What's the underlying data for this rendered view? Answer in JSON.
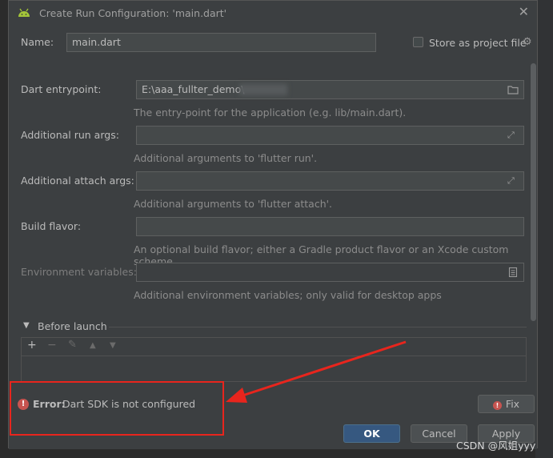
{
  "dialog": {
    "title": "Create Run Configuration: 'main.dart'",
    "close_glyph": "✕"
  },
  "name_row": {
    "label": "Name:",
    "value": "main.dart"
  },
  "store_project": {
    "label": "Store as project file",
    "checked": false,
    "icon": "gear-icon"
  },
  "fields": [
    {
      "label": "Dart entrypoint:",
      "value": "E:\\aaa_fullter_demo\\",
      "hint": "The entry-point for the application (e.g. lib/main.dart).",
      "icon": "folder-icon",
      "disabled": false
    },
    {
      "label": "Additional run args:",
      "value": "",
      "hint": "Additional arguments to 'flutter run'.",
      "icon": "expand-icon",
      "disabled": false
    },
    {
      "label": "Additional attach args:",
      "value": "",
      "hint": "Additional arguments to 'flutter attach'.",
      "icon": "expand-icon",
      "disabled": false
    },
    {
      "label": "Build flavor:",
      "value": "",
      "hint": "An optional build flavor; either a Gradle product flavor or an Xcode custom scheme.",
      "icon": "",
      "disabled": false
    },
    {
      "label": "Environment variables:",
      "value": "",
      "hint": "Additional environment variables; only valid for desktop apps",
      "icon": "document-icon",
      "disabled": true
    }
  ],
  "before_launch": {
    "label": "Before launch",
    "toolbar": [
      {
        "glyph": "+",
        "name": "add-icon",
        "enabled": true
      },
      {
        "glyph": "−",
        "name": "remove-icon",
        "enabled": false
      },
      {
        "glyph": "✎",
        "name": "edit-icon",
        "enabled": false
      },
      {
        "glyph": "▲",
        "name": "move-up-icon",
        "enabled": false
      },
      {
        "glyph": "▼",
        "name": "move-down-icon",
        "enabled": false
      }
    ]
  },
  "error": {
    "prefix": "Error:",
    "message": "Dart SDK is not configured",
    "fix_label": "Fix"
  },
  "buttons": {
    "ok": "OK",
    "cancel": "Cancel",
    "apply": "Apply"
  },
  "watermark": "CSDN @风姐yyy",
  "colors": {
    "accent": "#365880",
    "error": "#c75450",
    "annotation": "#e8251d"
  }
}
